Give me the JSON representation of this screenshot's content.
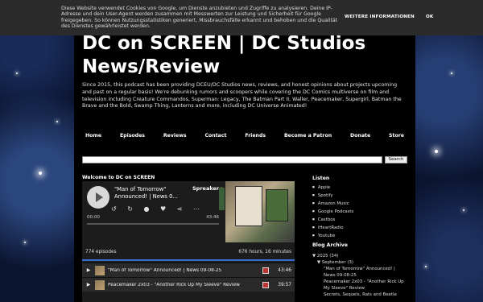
{
  "cookie": {
    "text": "Diese Website verwendet Cookies von Google, um Dienste anzubieten und Zugriffe zu analysieren. Deine IP-Adresse und dein User-Agent werden zusammen mit Messwerten zur Leistung und Sicherheit für Google freigegeben. So können Nutzungsstatistiken generiert, Missbrauchsfälle erkannt und behoben und die Qualität des Dienstes gewährleistet werden.",
    "more_info": "WEITERE INFORMATIONEN",
    "ok": "OK"
  },
  "site": {
    "title": "DC on SCREEN | DC Studios News/Review",
    "description": "Since 2015, this podcast has been providing DCEU/DC Studios news, reviews, and honest opinions about projects upcoming and past on a regular basis! We're debunking rumors and scoopers while covering the DC Comics multiverse on film and television including Creature Commandos, Superman: Legacy, The Batman Part II, Waller, Peacemaker, Supergirl, Batman the Brave and the Bold, Swamp Thing, Lanterns and more, including DC Universe Animated!"
  },
  "nav": [
    "Home",
    "Episodes",
    "Reviews",
    "Contact",
    "Friends",
    "Become a Patron",
    "Donate",
    "Store"
  ],
  "search": {
    "button": "Search",
    "placeholder": ""
  },
  "section_title": "Welcome to DC on SCREEN",
  "player": {
    "episode_title": "\"Man of Tomorrow\" Announced! | News 0...",
    "brand": "Spreaker",
    "current_time": "00:00",
    "duration": "43:46",
    "episodes_count": "774 episodes",
    "total_duration": "676 hours, 16 minutes",
    "episodes": [
      {
        "title": "\"Man of Tomorrow\" Announced! | News 09-08-25",
        "duration": "43:46"
      },
      {
        "title": "Peacemaker 2x03 - \"Another Rick Up My Sleeve\" Review",
        "duration": "39:57"
      }
    ]
  },
  "sidebar": {
    "listen_title": "Listen",
    "listen": [
      "Apple",
      "Spotify",
      "Amazon Music",
      "Google Podcasts",
      "Castbox",
      "iHeartRadio",
      "Youtube"
    ],
    "archive_title": "Blog Archive",
    "archive": {
      "year": "▼ 2025 (34)",
      "month": "▼ September (3)",
      "posts": [
        "\"Man of Tomorrow\" Announced! | News 09-08-25",
        "Peacemaker 2x03 - \"Another Rick Up My Sleeve\" Review",
        "Secrets, Sequels, Rats and Beetle"
      ]
    }
  }
}
